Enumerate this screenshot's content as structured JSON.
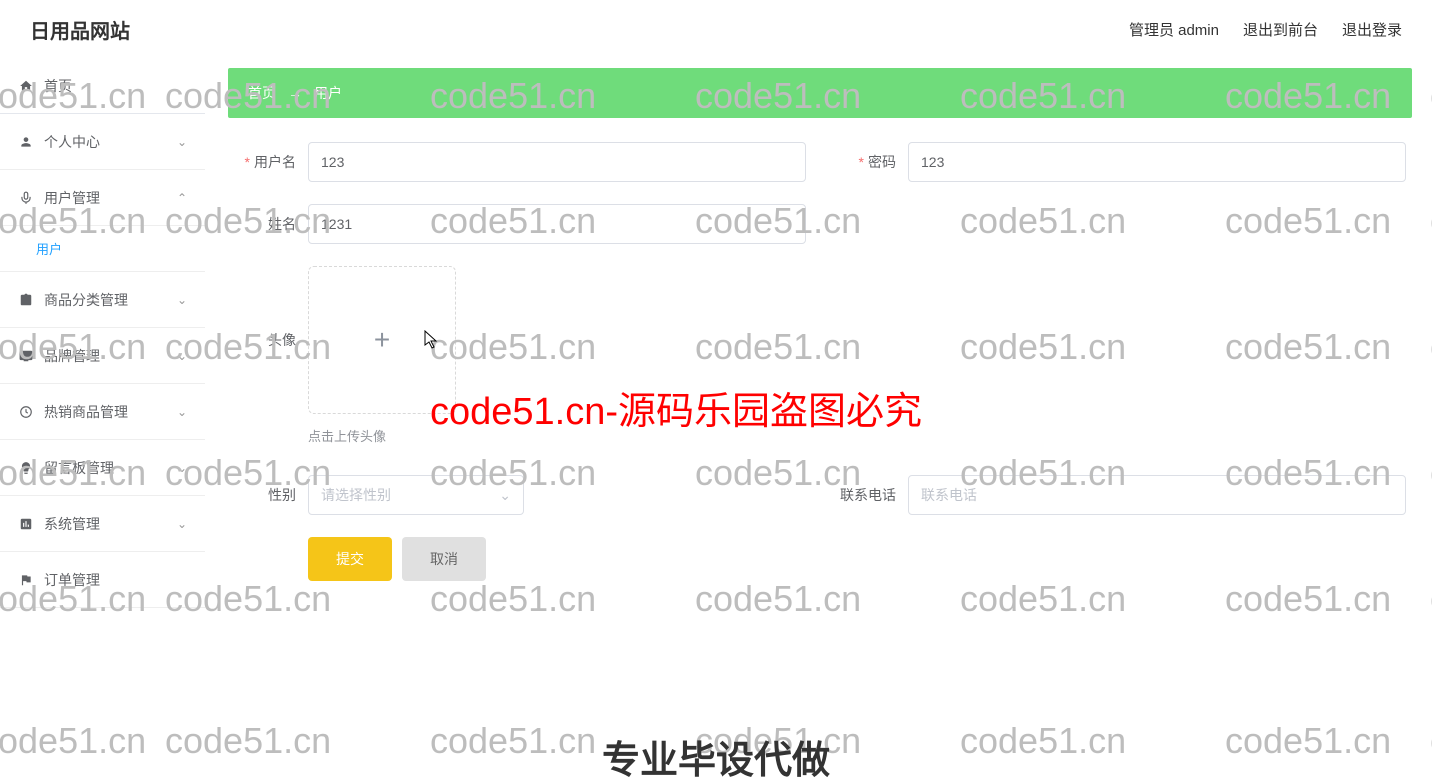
{
  "header": {
    "title": "日用品网站",
    "admin_label": "管理员 admin",
    "exit_home": "退出到前台",
    "exit_login": "退出登录"
  },
  "sidebar": {
    "home": "首页",
    "personal": "个人中心",
    "user_mgmt": "用户管理",
    "user_sub": "用户",
    "category": "商品分类管理",
    "brand": "品牌管理",
    "hot": "热销商品管理",
    "message": "留言板管理",
    "system": "系统管理",
    "order": "订单管理"
  },
  "breadcrumb": {
    "home": "首页",
    "current": "用户"
  },
  "form": {
    "username_label": "用户名",
    "username_value": "123",
    "password_label": "密码",
    "password_value": "123",
    "name_label": "姓名",
    "name_value": "1231",
    "avatar_label": "头像",
    "avatar_hint": "点击上传头像",
    "gender_label": "性别",
    "gender_placeholder": "请选择性别",
    "phone_label": "联系电话",
    "phone_placeholder": "联系电话",
    "submit": "提交",
    "cancel": "取消"
  },
  "watermark_text": "code51.cn",
  "watermark_red": "code51.cn-源码乐园盗图必究",
  "bottom_banner": "专业毕设代做"
}
